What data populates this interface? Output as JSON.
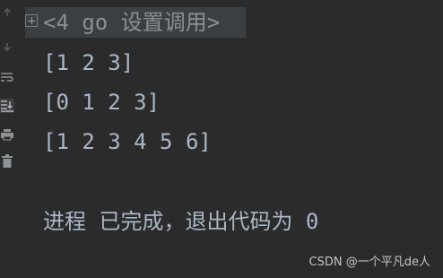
{
  "console": {
    "command": "<4 go 设置调用>",
    "outputs": [
      "[1 2 3]",
      "[0 1 2 3]",
      "[1 2 3 4 5 6]"
    ],
    "exit_message": "进程 已完成，退出代码为 0"
  },
  "gutter_icons": [
    "arrow-up-icon",
    "arrow-down-icon",
    "soft-wrap-icon",
    "scroll-to-end-icon",
    "print-icon",
    "trash-icon"
  ],
  "watermark": "CSDN @一个平凡de人",
  "colors": {
    "background": "#2b2b2b",
    "text": "#a9b7c6",
    "command_text": "#8a8f93",
    "fold_background": "#3c3f41"
  }
}
